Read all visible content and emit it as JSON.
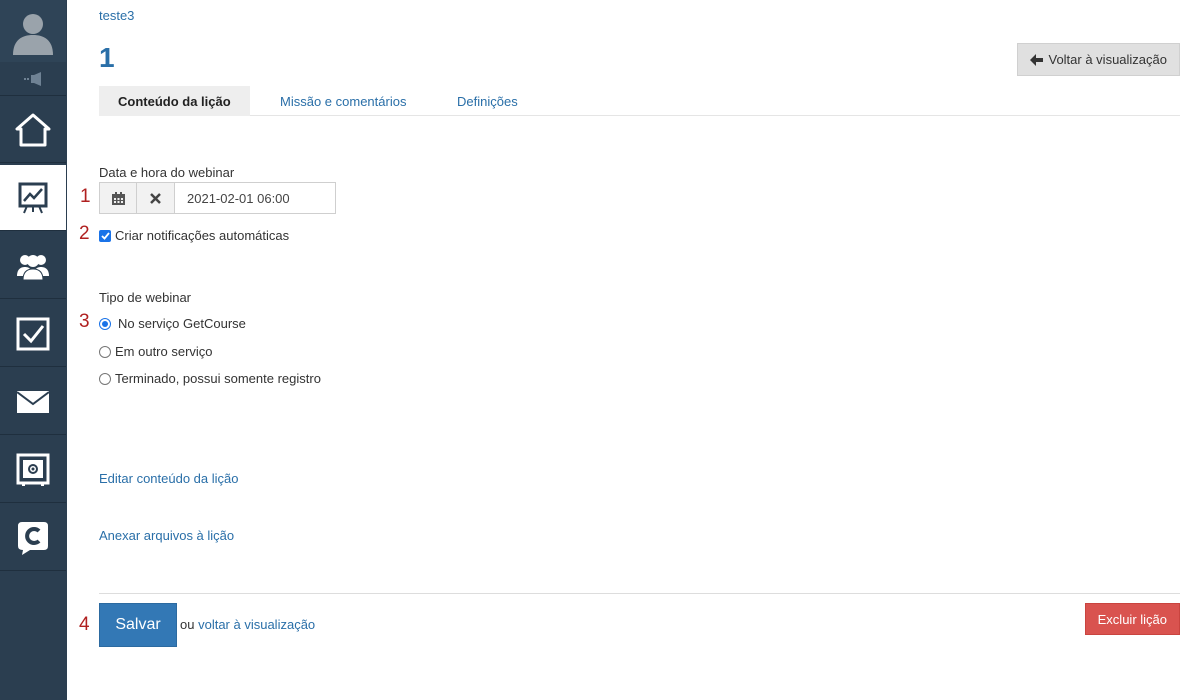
{
  "breadcrumb": "teste3",
  "page_title": "1",
  "back_button": "Voltar à visualização",
  "tabs": [
    {
      "label": "Conteúdo da lição"
    },
    {
      "label": "Missão e comentários"
    },
    {
      "label": "Definições"
    }
  ],
  "webinar_date": {
    "label": "Data e hora do webinar",
    "value": "2021-02-01 06:00"
  },
  "auto_notifications": "Criar notificações automáticas",
  "webinar_type": {
    "label": "Tipo de webinar",
    "options": [
      {
        "label": "No serviço GetCourse"
      },
      {
        "label": "Em outro serviço"
      },
      {
        "label": "Terminado, possui somente registro"
      }
    ]
  },
  "links": {
    "edit_content": "Editar conteúdo da lição",
    "attach_files": "Anexar arquivos à lição"
  },
  "footer": {
    "save": "Salvar",
    "or": "ou",
    "back_link": "voltar à visualização",
    "delete": "Excluir lição"
  },
  "markers": [
    "1",
    "2",
    "3",
    "4"
  ],
  "colors": {
    "sidebar": "#2b3e50",
    "link": "#2a6fa8",
    "primary": "#3378b5",
    "danger": "#d9534f",
    "marker": "#b02020"
  },
  "icons": {
    "sidebar": [
      "avatar-icon",
      "megaphone-icon",
      "home-icon",
      "training-chart-icon",
      "users-icon",
      "tasks-checkbox-icon",
      "mail-icon",
      "safe-settings-icon",
      "getcourse-logo-icon"
    ]
  }
}
